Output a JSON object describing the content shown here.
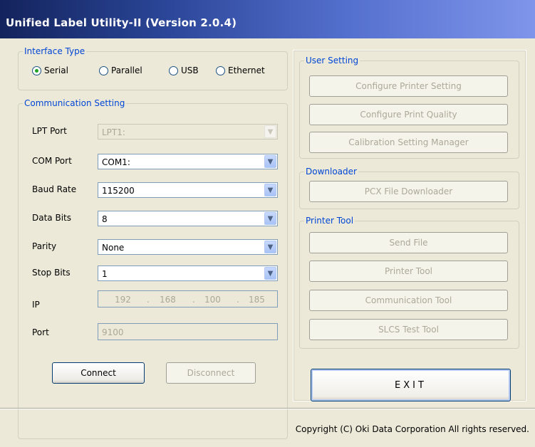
{
  "window": {
    "title": "Unified Label Utility-II (Version 2.0.4)"
  },
  "interface_type": {
    "legend": "Interface Type",
    "options": [
      {
        "label": "Serial",
        "selected": true
      },
      {
        "label": "Parallel",
        "selected": false
      },
      {
        "label": "USB",
        "selected": false
      },
      {
        "label": "Ethernet",
        "selected": false
      }
    ]
  },
  "communication": {
    "legend": "Communication Setting",
    "lpt_port": {
      "label": "LPT Port",
      "value": "LPT1:",
      "enabled": false
    },
    "com_port": {
      "label": "COM Port",
      "value": "COM1:"
    },
    "baud_rate": {
      "label": "Baud Rate",
      "value": "115200"
    },
    "data_bits": {
      "label": "Data Bits",
      "value": "8"
    },
    "parity": {
      "label": "Parity",
      "value": "None"
    },
    "stop_bits": {
      "label": "Stop Bits",
      "value": "1"
    },
    "ip": {
      "label": "IP",
      "octets": [
        "192",
        "168",
        "100",
        "185"
      ],
      "sep": ".",
      "enabled": false
    },
    "port": {
      "label": "Port",
      "value": "9100",
      "enabled": false
    },
    "connect_label": "Connect",
    "disconnect_label": "Disconnect"
  },
  "user_setting": {
    "legend": "User Setting",
    "configure_printer": "Configure Printer Setting",
    "configure_quality": "Configure Print Quality",
    "calibration": "Calibration Setting Manager"
  },
  "downloader": {
    "legend": "Downloader",
    "pcx": "PCX File Downloader"
  },
  "printer_tool": {
    "legend": "Printer Tool",
    "send_file": "Send File",
    "printer_tool": "Printer Tool",
    "communication_tool": "Communication Tool",
    "slcs_test_tool": "SLCS Test Tool"
  },
  "exit_label": "EXIT",
  "footer": {
    "copyright": "Copyright (C) Oki Data Corporation All rights reserved."
  },
  "colors": {
    "legend": "#0046d5",
    "face": "#ece9d8",
    "title_dark": "#13235c",
    "title_light": "#7f95ea"
  }
}
